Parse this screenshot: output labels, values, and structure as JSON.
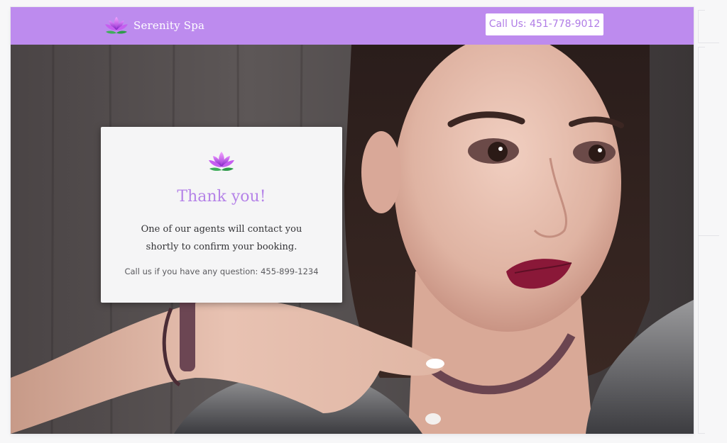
{
  "header": {
    "brand_name": "Serenity Spa",
    "logo_icon": "lotus-icon",
    "call_button_label": "Call Us: 451-778-9012"
  },
  "confirmation": {
    "icon": "lotus-icon",
    "title": "Thank you!",
    "message": "One of our agents will contact you shortly to confirm your booking.",
    "phone_line": "Call us if you have any question: 455-899-1234"
  },
  "hero": {
    "image": "woman-portrait-photo"
  },
  "colors": {
    "accent": "#bd8bee",
    "title": "#b583e8",
    "card_background": "#f5f5f6"
  }
}
